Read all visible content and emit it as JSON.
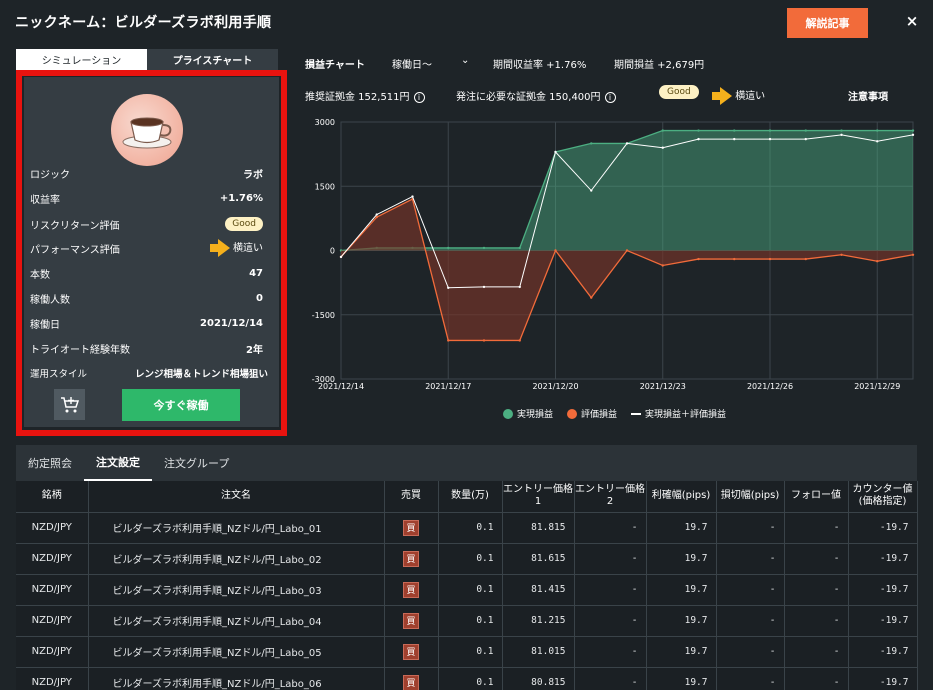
{
  "header": {
    "title": "ニックネーム：ビルダーズラボ利用手順",
    "article_button": "解説記事",
    "close": "×"
  },
  "left_tabs": [
    "シミュレーション",
    "プライスチャート"
  ],
  "strategy": {
    "stats": [
      {
        "label": "ロジック",
        "value": "ラボ"
      },
      {
        "label": "収益率",
        "value": "+1.76%"
      },
      {
        "label": "リスクリターン評価",
        "value": "Good"
      },
      {
        "label": "パフォーマンス評価",
        "value": "横這い"
      },
      {
        "label": "本数",
        "value": "47"
      },
      {
        "label": "稼働人数",
        "value": "0"
      },
      {
        "label": "稼働日",
        "value": "2021/12/14"
      },
      {
        "label": "トライオート経験年数",
        "value": "2年"
      },
      {
        "label": "運用スタイル",
        "value": "レンジ相場＆トレンド相場狙い"
      }
    ],
    "run_button": "今すぐ稼働"
  },
  "chart_header": {
    "chart_title": "損益チャート",
    "period_select": "稼働日〜",
    "period_return": "期間収益率 +1.76%",
    "period_pl": "期間損益 +2,679円",
    "recommended_margin": "推奨証拠金 152,511円",
    "required_margin": "発注に必要な証拠金 150,400円",
    "risk_badge": "Good",
    "performance": "横這い",
    "notes": "注意事項"
  },
  "chart_data": {
    "type": "area",
    "x": [
      "2021/12/14",
      "2021/12/15",
      "2021/12/16",
      "2021/12/17",
      "2021/12/18",
      "2021/12/19",
      "2021/12/20",
      "2021/12/21",
      "2021/12/22",
      "2021/12/23",
      "2021/12/24",
      "2021/12/25",
      "2021/12/26",
      "2021/12/27",
      "2021/12/28",
      "2021/12/29",
      "2021/12/30"
    ],
    "x_ticks": [
      "2021/12/14",
      "2021/12/17",
      "2021/12/20",
      "2021/12/23",
      "2021/12/26",
      "2021/12/29"
    ],
    "ylim": [
      -3000,
      3000
    ],
    "y_ticks": [
      "3000",
      "1500",
      "0",
      "-1500",
      "-3000"
    ],
    "series": [
      {
        "name": "実現損益",
        "color": "#4caf82",
        "values": [
          0,
          60,
          60,
          60,
          60,
          60,
          2300,
          2500,
          2500,
          2800,
          2800,
          2800,
          2800,
          2800,
          2800,
          2800,
          2800
        ]
      },
      {
        "name": "評価損益",
        "color": "#f26b3a",
        "values": [
          -150,
          780,
          1200,
          -2100,
          -2100,
          -2100,
          0,
          -1100,
          0,
          -350,
          -200,
          -200,
          -200,
          -200,
          -100,
          -250,
          -100
        ]
      },
      {
        "name": "実現損益＋評価損益",
        "color": "#ffffff",
        "values": [
          -150,
          840,
          1260,
          -870,
          -850,
          -850,
          2300,
          1400,
          2500,
          2400,
          2600,
          2600,
          2600,
          2600,
          2700,
          2550,
          2700
        ]
      }
    ]
  },
  "bottom_tabs": [
    "約定照会",
    "注文設定",
    "注文グループ"
  ],
  "table": {
    "headers": [
      "銘柄",
      "注文名",
      "売買",
      "数量(万)",
      "エントリー価格1",
      "エントリー価格2",
      "利確幅(pips)",
      "損切幅(pips)",
      "フォロー値",
      "カウンター値(価格指定)"
    ],
    "rows": [
      [
        "NZD/JPY",
        "ビルダーズラボ利用手順_NZドル/円_Labo_01",
        "買",
        "0.1",
        "81.815",
        "-",
        "19.7",
        "-",
        "-",
        "-19.7"
      ],
      [
        "NZD/JPY",
        "ビルダーズラボ利用手順_NZドル/円_Labo_02",
        "買",
        "0.1",
        "81.615",
        "-",
        "19.7",
        "-",
        "-",
        "-19.7"
      ],
      [
        "NZD/JPY",
        "ビルダーズラボ利用手順_NZドル/円_Labo_03",
        "買",
        "0.1",
        "81.415",
        "-",
        "19.7",
        "-",
        "-",
        "-19.7"
      ],
      [
        "NZD/JPY",
        "ビルダーズラボ利用手順_NZドル/円_Labo_04",
        "買",
        "0.1",
        "81.215",
        "-",
        "19.7",
        "-",
        "-",
        "-19.7"
      ],
      [
        "NZD/JPY",
        "ビルダーズラボ利用手順_NZドル/円_Labo_05",
        "買",
        "0.1",
        "81.015",
        "-",
        "19.7",
        "-",
        "-",
        "-19.7"
      ],
      [
        "NZD/JPY",
        "ビルダーズラボ利用手順_NZドル/円_Labo_06",
        "買",
        "0.1",
        "80.815",
        "-",
        "19.7",
        "-",
        "-",
        "-19.7"
      ]
    ]
  }
}
